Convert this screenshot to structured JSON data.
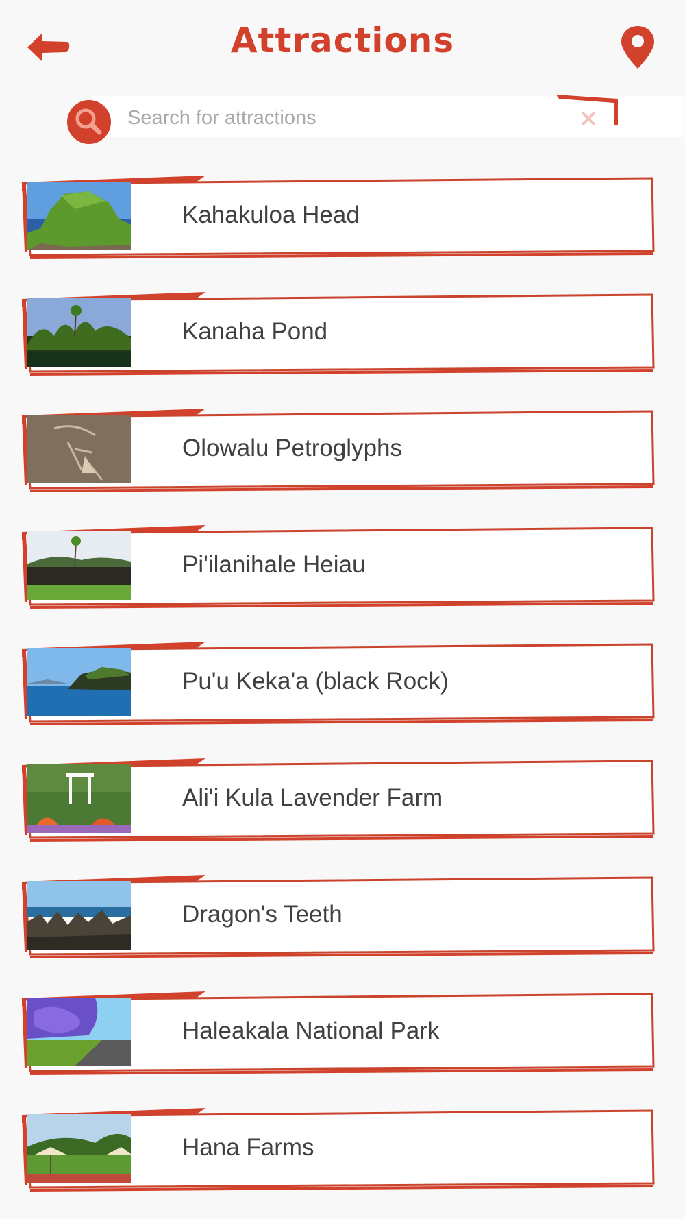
{
  "header": {
    "title": "Attractions"
  },
  "search": {
    "placeholder": "Search for attractions",
    "value": ""
  },
  "colors": {
    "accent": "#d2412b",
    "background": "#f8f8f8",
    "card": "#ffffff"
  },
  "attractions": [
    {
      "name": "Kahakuloa Head",
      "image": "green-headland-cliffs"
    },
    {
      "name": "Kanaha Pond",
      "image": "palm-trees-pond"
    },
    {
      "name": "Olowalu Petroglyphs",
      "image": "rock-petroglyph"
    },
    {
      "name": "Pi'ilanihale Heiau",
      "image": "stone-platform-field"
    },
    {
      "name": "Pu'u Keka'a (black Rock)",
      "image": "ocean-black-rock"
    },
    {
      "name": "Ali'i Kula Lavender Farm",
      "image": "lavender-garden-gazebo"
    },
    {
      "name": "Dragon's Teeth",
      "image": "jagged-lava-coast"
    },
    {
      "name": "Haleakala National Park",
      "image": "jacaranda-road"
    },
    {
      "name": "Hana Farms",
      "image": "farm-garden-umbrellas"
    }
  ]
}
